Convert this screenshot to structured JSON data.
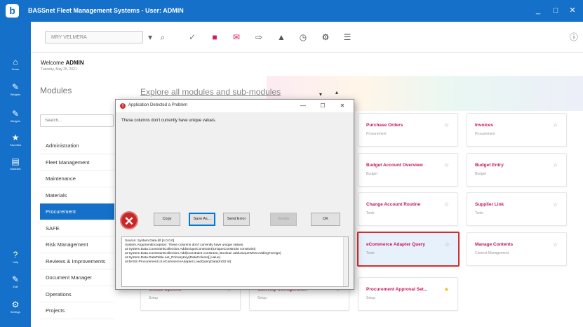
{
  "window": {
    "title": "BASSnet Fleet Management Systems - User: ADMIN",
    "minimize": "_",
    "maximize": "□",
    "close": "✕"
  },
  "leftnav": [
    {
      "icon": "home-icon",
      "glyph": "⌂",
      "label": "Home"
    },
    {
      "icon": "user-icon",
      "glyph": "✎",
      "label": "Widgets"
    },
    {
      "icon": "widgets-icon",
      "glyph": "✎",
      "label": "Widgets"
    },
    {
      "icon": "favorites-icon",
      "glyph": "★",
      "label": "Favorites"
    },
    {
      "icon": "modules-icon",
      "glyph": "▤",
      "label": "Modules"
    },
    {
      "icon": "help-icon",
      "glyph": "?",
      "label": "Help"
    },
    {
      "icon": "edit-icon",
      "glyph": "✎",
      "label": "Edit"
    },
    {
      "icon": "settings-icon",
      "glyph": "⚙",
      "label": "Settings"
    }
  ],
  "toolbar": {
    "search_value": "MRY VELMERA",
    "icons": [
      {
        "name": "dropdown-icon",
        "glyph": "▾",
        "color": "#666666"
      },
      {
        "name": "search-icon",
        "glyph": "⌕",
        "color": "#666666"
      },
      {
        "name": "checkmark-icon",
        "glyph": "✓",
        "color": "#777777"
      },
      {
        "name": "flag-icon",
        "glyph": "■",
        "color": "#d81b60"
      },
      {
        "name": "mail-icon",
        "glyph": "✉",
        "color": "#d81b60"
      },
      {
        "name": "share-icon",
        "glyph": "⇨",
        "color": "#555555"
      },
      {
        "name": "tray-icon",
        "glyph": "▲",
        "color": "#555555"
      },
      {
        "name": "clock-icon",
        "glyph": "◷",
        "color": "#555555"
      },
      {
        "name": "gear-icon",
        "glyph": "⚙",
        "color": "#333333"
      },
      {
        "name": "list-icon",
        "glyph": "☰",
        "color": "#555555"
      }
    ],
    "info_icon": "ⓘ"
  },
  "welcome": {
    "greeting": "Welcome",
    "user": "ADMIN",
    "date": "Tuesday, May 25, 2021"
  },
  "modules": {
    "title": "Modules",
    "explore": "Explore all modules and sub-modules",
    "chevron_down": "▾",
    "chevron_up": "▴",
    "search_placeholder": "Search...",
    "items": [
      "Administration",
      "Fleet Management",
      "Maintenance",
      "Materials",
      "Procurement",
      "SAFE",
      "Risk Management",
      "Reviews & Improvements",
      "Document Manager",
      "Operations",
      "Projects"
    ],
    "active_index": 4
  },
  "cards": [
    {
      "title": "Purchase Orders",
      "sub": "Procurement",
      "star": "☆",
      "fav": false
    },
    {
      "title": "Invoices",
      "sub": "Procurement",
      "star": "☆",
      "fav": false
    },
    {
      "title": "Budget Account Overview",
      "sub": "Budget",
      "star": "☆",
      "fav": false
    },
    {
      "title": "Budget Entry",
      "sub": "Budget",
      "star": "☆",
      "fav": false
    },
    {
      "title": "Change Account Routine",
      "sub": "Tools",
      "star": "☆",
      "fav": false
    },
    {
      "title": "Supplier Link",
      "sub": "Tools",
      "star": "☆",
      "fav": false
    },
    {
      "title": "eCommerce Adapter Query",
      "sub": "Tools",
      "star": "☆",
      "fav": false
    },
    {
      "title": "Manage Contents",
      "sub": "Content Management",
      "star": "☆",
      "fav": false
    },
    {
      "title": "Global Options",
      "sub": "Setup",
      "star": "☆",
      "fav": false
    },
    {
      "title": "Gateway Configuration",
      "sub": "Setup",
      "star": "☆",
      "fav": false
    },
    {
      "title": "Procurement Approval Set...",
      "sub": "Setup",
      "star": "★",
      "fav": true
    }
  ],
  "dialog": {
    "title": "Application Detected a Problem",
    "min": "—",
    "max": "☐",
    "close": "✕",
    "message": "These columns don't currently have unique values.",
    "error_glyph": "✕",
    "buttons": [
      "Copy",
      "Save As...",
      "Send Error",
      "Details",
      "OK"
    ],
    "details": [
      "Source: System.Data.dll [4.0.0.0]",
      "System.ArgumentException: These columns don't currently have unique values.",
      "   at System.Data.ConstraintCollection.AddUniqueConstraint(UniqueConstraint constraint)",
      "   at System.Data.ConstraintCollection.Add(Constraint constraint, Boolean addUniqueWhenAddingForeign)",
      "   at System.Data.DataTable.set_PrimaryKey(DataColumn[] value)",
      "   at BASS.Procurement.UI.eCommerceAdapter.LoadQueryData(Int32 id)"
    ]
  }
}
